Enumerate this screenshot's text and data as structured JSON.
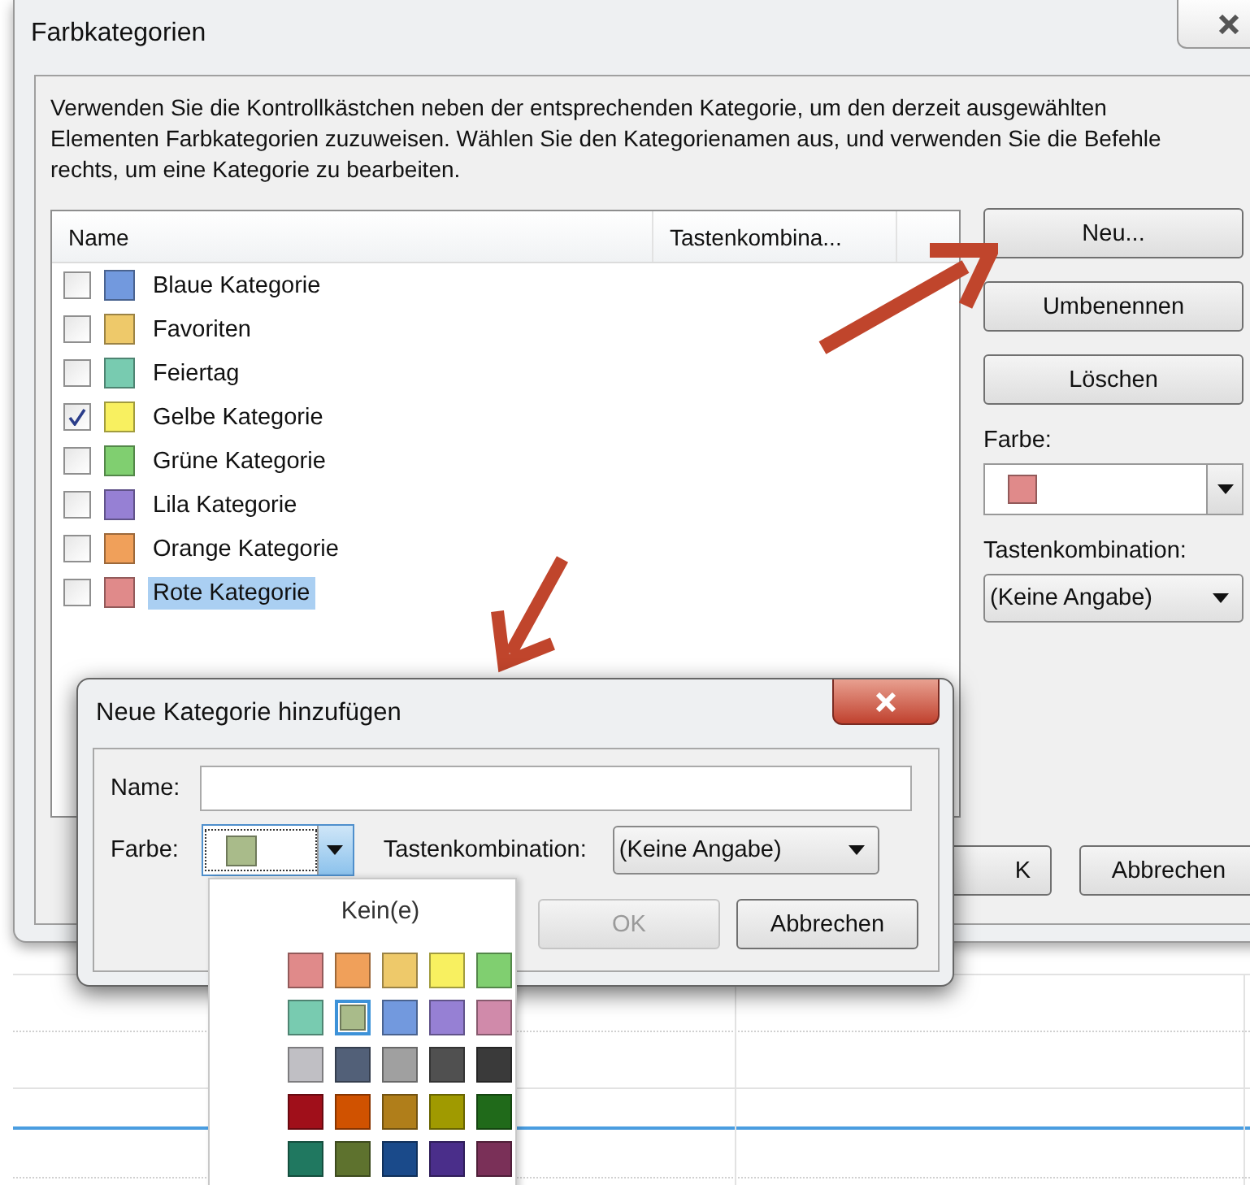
{
  "main_dialog": {
    "title": "Farbkategorien",
    "description": "Verwenden Sie die Kontrollkästchen neben der entsprechenden Kategorie, um den derzeit ausgewählten Elementen Farbkategorien zuzuweisen. Wählen Sie den Kategorienamen aus, und verwenden Sie die Befehle rechts, um eine Kategorie zu bearbeiten.",
    "columns": [
      "Name",
      "Tastenkombina..."
    ],
    "categories": [
      {
        "name": "Blaue Kategorie",
        "color": "#7299de",
        "checked": false,
        "selected": false
      },
      {
        "name": "Favoriten",
        "color": "#eec96a",
        "checked": false,
        "selected": false
      },
      {
        "name": "Feiertag",
        "color": "#78cbb0",
        "checked": false,
        "selected": false
      },
      {
        "name": "Gelbe Kategorie",
        "color": "#f8f060",
        "checked": true,
        "selected": false
      },
      {
        "name": "Grüne Kategorie",
        "color": "#80cf70",
        "checked": false,
        "selected": false
      },
      {
        "name": "Lila Kategorie",
        "color": "#9680d4",
        "checked": false,
        "selected": false
      },
      {
        "name": "Orange Kategorie",
        "color": "#f0a05a",
        "checked": false,
        "selected": false
      },
      {
        "name": "Rote Kategorie",
        "color": "#e08a8a",
        "checked": false,
        "selected": true
      }
    ],
    "buttons": [
      "Neu...",
      "Umbenennen",
      "Löschen"
    ],
    "color_label": "Farbe:",
    "color_value": {
      "color": "#e08a8a"
    },
    "shortcut_label": "Tastenkombination:",
    "shortcut_value": "(Keine Angabe)",
    "footer_buttons": [
      "K",
      "Abbrechen"
    ]
  },
  "new_category_dialog": {
    "title": "Neue Kategorie hinzufügen",
    "name_label": "Name:",
    "color_label": "Farbe:",
    "color_value": {
      "color": "#a9bb8a"
    },
    "shortcut_label": "Tastenkombination:",
    "shortcut_value": "(Keine Angabe)",
    "buttons": [
      {
        "label": "OK",
        "disabled": true
      },
      {
        "label": "Abbrechen",
        "disabled": false
      }
    ]
  },
  "color_palette": {
    "none_label": "Kein(e)",
    "swatches": [
      {
        "color": "#e08a8a",
        "selected": false
      },
      {
        "color": "#f0a05a",
        "selected": false
      },
      {
        "color": "#eec96a",
        "selected": false
      },
      {
        "color": "#f8f060",
        "selected": false
      },
      {
        "color": "#80cf70",
        "selected": false
      },
      {
        "color": "#78cbb0",
        "selected": false
      },
      {
        "color": "#a9bb8a",
        "selected": true
      },
      {
        "color": "#7299de",
        "selected": false
      },
      {
        "color": "#9680d4",
        "selected": false
      },
      {
        "color": "#d08aaa",
        "selected": false
      },
      {
        "color": "#c0bfc4",
        "selected": false
      },
      {
        "color": "#526078",
        "selected": false
      },
      {
        "color": "#a0a0a0",
        "selected": false
      },
      {
        "color": "#505050",
        "selected": false
      },
      {
        "color": "#3a3a3a",
        "selected": false
      },
      {
        "color": "#a00f1a",
        "selected": false
      },
      {
        "color": "#d05200",
        "selected": false
      },
      {
        "color": "#b07e1a",
        "selected": false
      },
      {
        "color": "#a09a00",
        "selected": false
      },
      {
        "color": "#206a1a",
        "selected": false
      },
      {
        "color": "#207860",
        "selected": false
      },
      {
        "color": "#5e722e",
        "selected": false
      },
      {
        "color": "#1a4a8a",
        "selected": false
      },
      {
        "color": "#4a2e8a",
        "selected": false
      },
      {
        "color": "#7a3058",
        "selected": false
      }
    ]
  }
}
